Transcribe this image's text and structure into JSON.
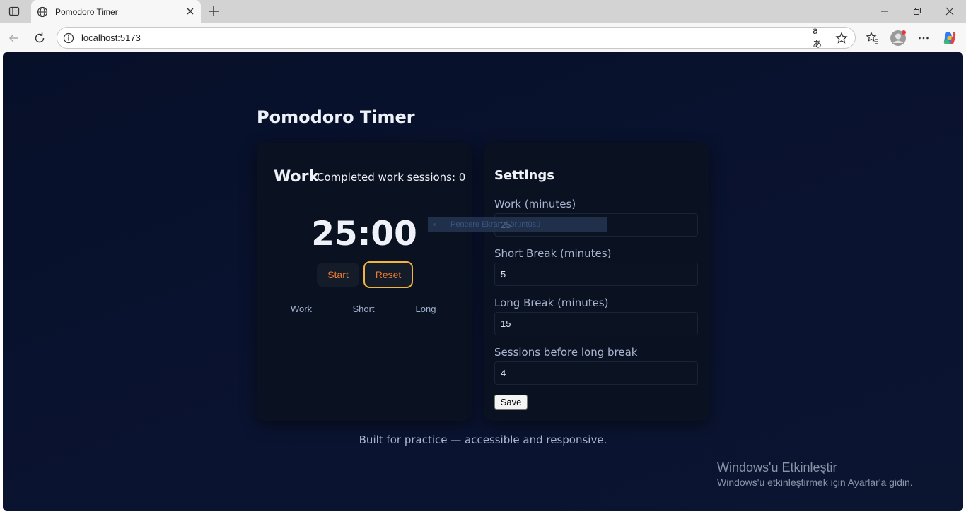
{
  "browser": {
    "tab_title": "Pomodoro Timer",
    "url": "localhost:5173"
  },
  "app": {
    "title": "Pomodoro Timer",
    "timer": {
      "mode": "Work",
      "sessions_text": "Completed work sessions: 0",
      "countdown": "25:00",
      "start_label": "Start",
      "reset_label": "Reset",
      "modes": [
        "Work",
        "Short",
        "Long"
      ]
    },
    "settings": {
      "title": "Settings",
      "fields": [
        {
          "label": "Work (minutes)",
          "value": "25"
        },
        {
          "label": "Short Break (minutes)",
          "value": "5"
        },
        {
          "label": "Long Break (minutes)",
          "value": "15"
        },
        {
          "label": "Sessions before long break",
          "value": "4"
        }
      ],
      "save_label": "Save"
    },
    "footer": "Built for practice — accessible and responsive."
  },
  "overlay": {
    "tooltip": "Pencere Ekran Görüntüsü"
  },
  "activation": {
    "title": "Windows'u Etkinleştir",
    "subtitle": "Windows'u etkinleştirmek için Ayarlar'a gidin."
  },
  "colors": {
    "page_bg": "#071029",
    "card_bg": "#0a1120",
    "accent_orange": "#f07c30",
    "focus_ring": "#f4b43c"
  }
}
